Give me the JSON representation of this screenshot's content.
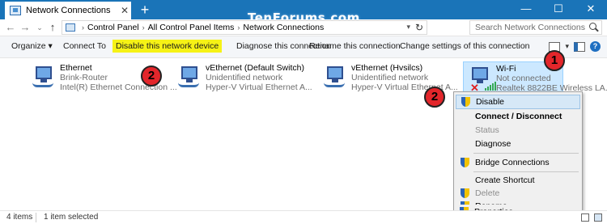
{
  "titlebar": {
    "tab_title": "Network Connections",
    "tab_close": "✕",
    "new_tab": "+",
    "watermark": "TenForums.com",
    "minimize": "—",
    "maximize": "☐",
    "close": "✕"
  },
  "nav": {
    "back": "←",
    "forward": "→",
    "recent": "⌄",
    "up": "↑"
  },
  "address": {
    "crumbs": [
      "Control Panel",
      "All Control Panel Items",
      "Network Connections"
    ],
    "separator": "›",
    "search_placeholder": "Search Network Connections"
  },
  "commands": {
    "organize": "Organize ▾",
    "connect_to": "Connect To",
    "disable": "Disable this network device",
    "diagnose": "Diagnose this connection",
    "rename": "Rename this connection",
    "change_settings": "Change settings of this connection",
    "help": "?"
  },
  "adapters": [
    {
      "name": "Ethernet",
      "status": "Brink-Router",
      "device": "Intel(R) Ethernet Connection ..."
    },
    {
      "name": "vEthernet (Default Switch)",
      "status": "Unidentified network",
      "device": "Hyper-V Virtual Ethernet A..."
    },
    {
      "name": "vEthernet (Hvsilcs)",
      "status": "Unidentified network",
      "device": "Hyper-V Virtual Ethernet A..."
    },
    {
      "name": "Wi-Fi",
      "status": "Not connected",
      "device": "Realtek 8822BE Wireless LA..."
    }
  ],
  "context_menu": {
    "items": [
      {
        "label": "Disable"
      },
      {
        "label": "Connect / Disconnect"
      },
      {
        "label": "Status"
      },
      {
        "label": "Diagnose"
      },
      {
        "label": "Bridge Connections"
      },
      {
        "label": "Create Shortcut"
      },
      {
        "label": "Delete"
      },
      {
        "label": "Rename"
      },
      {
        "label": "Properties"
      }
    ]
  },
  "callouts": {
    "one": "1",
    "two_toolbar": "2",
    "two_menu": "2"
  },
  "statusbar": {
    "item_count": "4 items",
    "selection": "1 item selected"
  },
  "colors": {
    "titlebar": "#1a74b8",
    "highlight": "#f6f216",
    "selection": "#cce8ff",
    "callout": "#e3262b"
  }
}
